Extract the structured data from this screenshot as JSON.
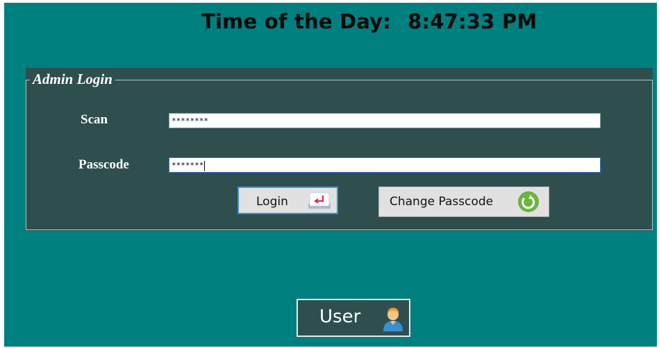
{
  "header": {
    "clock_label": "Time of the Day:",
    "clock_value": "8:47:33 PM"
  },
  "admin_login": {
    "title": "Admin Login",
    "scan_label": "Scan",
    "scan_value": "********",
    "passcode_label": "Passcode",
    "passcode_value": "*******",
    "login_button": "Login",
    "change_passcode_button": "Change Passcode"
  },
  "user_button": "User",
  "icons": {
    "login": "enter-key-icon",
    "change_passcode": "refresh-icon",
    "user": "user-person-icon"
  },
  "colors": {
    "background": "#007f7f",
    "panel": "#2f4f4f",
    "refresh_green": "#6cb33f",
    "enter_red": "#e0204a"
  }
}
